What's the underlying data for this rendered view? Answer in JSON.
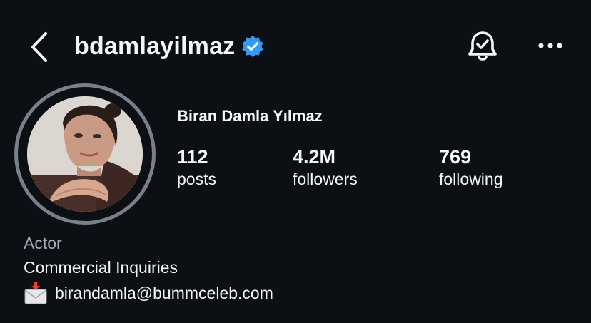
{
  "header": {
    "username": "bdamlayilmaz",
    "icons": [
      "back-arrow-icon",
      "verified-badge-icon",
      "notification-bell-icon",
      "more-options-icon"
    ]
  },
  "profile": {
    "full_name": "Biran Damla Yılmaz",
    "stats": [
      {
        "value": "112",
        "label": "posts"
      },
      {
        "value": "4.2M",
        "label": "followers"
      },
      {
        "value": "769",
        "label": "following"
      }
    ]
  },
  "bio": {
    "category": "Actor",
    "line1": "Commercial Inquiries",
    "email": "birandamla@bummceleb.com",
    "email_icon": "incoming-envelope-icon"
  },
  "colors": {
    "background": "#0c1014",
    "text": "#f5f5f5",
    "muted": "#a8adb5",
    "verified": "#3897f0",
    "avatar_ring": "#7a8089"
  }
}
